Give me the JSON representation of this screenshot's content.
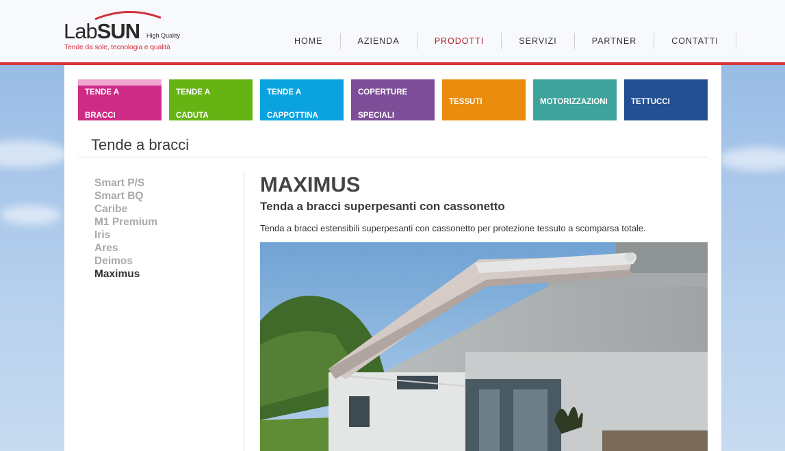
{
  "brand": {
    "name_lab": "Lab",
    "name_sun": "SUN",
    "badge": "High Quality",
    "tagline": "Tende da sole, tecnologia e qualità"
  },
  "nav": [
    {
      "label": "HOME",
      "active": false
    },
    {
      "label": "AZIENDA",
      "active": false
    },
    {
      "label": "PRODOTTI",
      "active": true
    },
    {
      "label": "SERVIZI",
      "active": false
    },
    {
      "label": "PARTNER",
      "active": false
    },
    {
      "label": "CONTATTI",
      "active": false
    }
  ],
  "categories": [
    {
      "label": "TENDE A BRACCI",
      "line1": "TENDE A",
      "line2": "BRACCI",
      "color": "#cd2b86",
      "active": true
    },
    {
      "label": "TENDE A CADUTA",
      "line1": "TENDE A",
      "line2": "CADUTA",
      "color": "#66b414"
    },
    {
      "label": "TENDE A CAPPOTTINA",
      "line1": "TENDE A",
      "line2": "CAPPOTTINA",
      "color": "#0aa3e0"
    },
    {
      "label": "COPERTURE SPECIALI",
      "line1": "COPERTURE",
      "line2": "SPECIALI",
      "color": "#7d4d98"
    },
    {
      "label": "TESSUTI",
      "line1": "TESSUTI",
      "line2": "",
      "color": "#ea8c0d"
    },
    {
      "label": "MOTORIZZAZIONI",
      "line1": "MOTORIZZAZIONI",
      "line2": "",
      "color": "#3ea39a"
    },
    {
      "label": "TETTUCCI",
      "line1": "TETTUCCI",
      "line2": "",
      "color": "#234f93"
    }
  ],
  "section": {
    "title": "Tende a bracci"
  },
  "sidebar": [
    {
      "label": "Smart P/S",
      "active": false
    },
    {
      "label": "Smart BQ",
      "active": false
    },
    {
      "label": "Caribe",
      "active": false
    },
    {
      "label": "M1 Premium",
      "active": false
    },
    {
      "label": "Iris",
      "active": false
    },
    {
      "label": "Ares",
      "active": false
    },
    {
      "label": "Deimos",
      "active": false
    },
    {
      "label": "Maximus",
      "active": true
    }
  ],
  "product": {
    "title": "MAXIMUS",
    "subtitle": "Tenda a bracci superpesanti con cassonetto",
    "description": "Tenda a bracci estensibili superpesanti con cassonetto per protezione tessuto a scomparsa totale."
  },
  "colors": {
    "accent": "#d8343a",
    "nav_active": "#b3202b"
  }
}
